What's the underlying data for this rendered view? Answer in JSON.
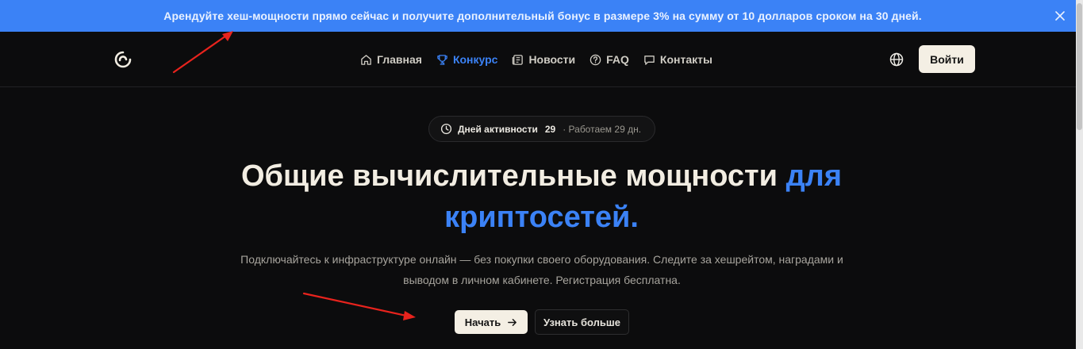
{
  "promo": {
    "text": "Арендуйте хеш-мощности прямо сейчас и получите дополнительный бонус в размере 3% на сумму от 10 долларов сроком на 30 дней.",
    "close_icon": "close-icon",
    "bg_color": "#3b82f6"
  },
  "header": {
    "logo_icon": "brand-logo-icon",
    "nav": [
      {
        "label": "Главная",
        "icon": "home-icon",
        "active": false
      },
      {
        "label": "Конкурс",
        "icon": "trophy-icon",
        "active": true
      },
      {
        "label": "Новости",
        "icon": "newspaper-icon",
        "active": false
      },
      {
        "label": "FAQ",
        "icon": "help-circle-icon",
        "active": false
      },
      {
        "label": "Контакты",
        "icon": "chat-icon",
        "active": false
      }
    ],
    "language_icon": "globe-icon",
    "login_label": "Войти"
  },
  "hero": {
    "activity": {
      "label": "Дней активности",
      "count": "29",
      "sub": "· Работаем 29 дн."
    },
    "title_main": "Общие вычислительные мощности ",
    "title_accent_1": "для",
    "title_accent_2": "криптосетей.",
    "description": "Подключайтесь к инфраструктуре онлайн — без покупки своего оборудования. Следите за хешрейтом, наградами и выводом в личном кабинете. Регистрация бесплатна.",
    "start_label": "Начать",
    "more_label": "Узнать больше"
  },
  "colors": {
    "accent": "#3b82f6",
    "background": "#0c0c0d",
    "button_light": "#f4efe4",
    "annotation": "#e8231d"
  }
}
